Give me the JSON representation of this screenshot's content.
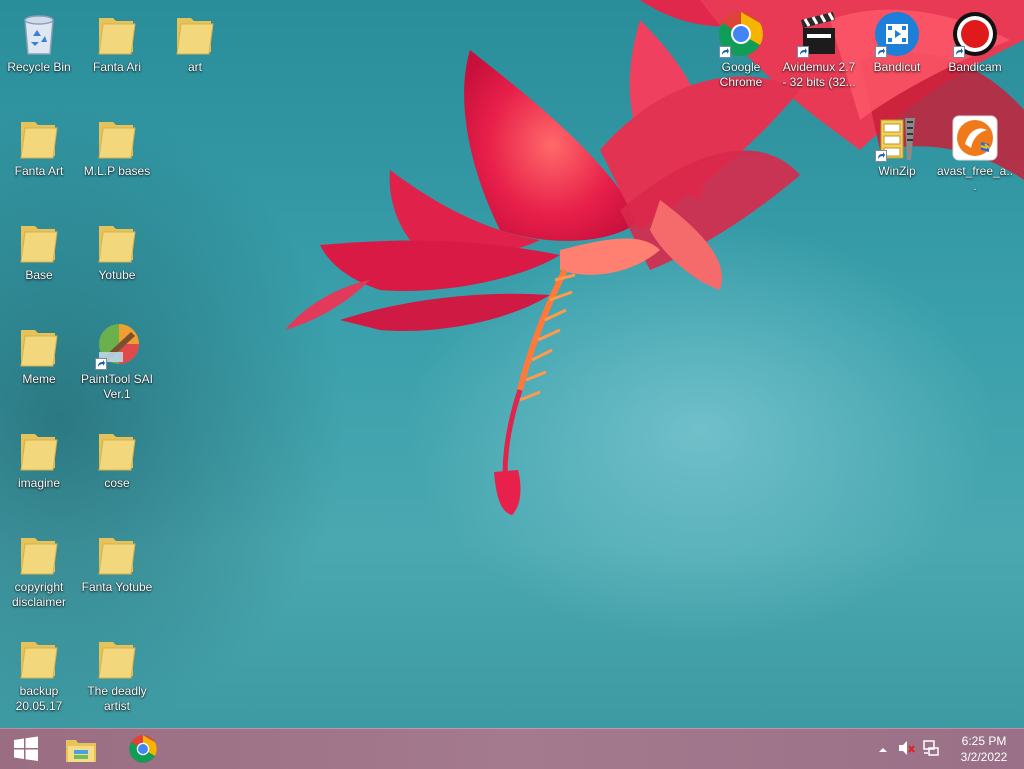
{
  "desktop": {
    "left_icons": [
      {
        "label": "Recycle Bin",
        "icon": "recycle-bin-icon"
      },
      {
        "label": "Fanta Ari",
        "icon": "folder-icon"
      },
      {
        "label": "art",
        "icon": "folder-icon"
      },
      {
        "label": "Fanta Art",
        "icon": "folder-icon"
      },
      {
        "label": "M.L.P bases",
        "icon": "folder-icon"
      },
      {
        "label": "Base",
        "icon": "folder-icon"
      },
      {
        "label": "Yotube",
        "icon": "folder-icon"
      },
      {
        "label": "Meme",
        "icon": "folder-icon"
      },
      {
        "label": "PaintTool SAI Ver.1",
        "icon": "painttool-sai-icon"
      },
      {
        "label": "imagine",
        "icon": "folder-icon"
      },
      {
        "label": "cose",
        "icon": "folder-icon"
      },
      {
        "label": "copyright disclaimer",
        "icon": "folder-icon"
      },
      {
        "label": "Fanta Yotube",
        "icon": "folder-icon"
      },
      {
        "label": "backup 20.05.17",
        "icon": "folder-icon"
      },
      {
        "label": "The deadly artist",
        "icon": "folder-icon"
      }
    ],
    "right_icons": [
      {
        "label": "Google Chrome",
        "icon": "chrome-icon"
      },
      {
        "label": "Avidemux 2.7 - 32 bits (32...",
        "icon": "avidemux-icon"
      },
      {
        "label": "Bandicut",
        "icon": "bandicut-icon"
      },
      {
        "label": "Bandicam",
        "icon": "bandicam-icon"
      },
      {
        "label": "WinZip",
        "icon": "winzip-icon"
      },
      {
        "label": "avast_free_a...",
        "icon": "avast-icon"
      }
    ]
  },
  "taskbar": {
    "start_icon": "windows-start-icon",
    "pinned": [
      {
        "name": "File Explorer",
        "icon": "file-explorer-icon"
      },
      {
        "name": "Google Chrome",
        "icon": "chrome-icon"
      }
    ],
    "tray": {
      "time": "6:25 PM",
      "date": "3/2/2022",
      "icons": [
        "show-hidden-icons-icon",
        "volume-muted-icon",
        "network-icon"
      ]
    }
  },
  "colors": {
    "taskbar": "#a47a8e",
    "desktop_background": "#3aa0ab",
    "folder_yellow": "#f3d77c"
  }
}
